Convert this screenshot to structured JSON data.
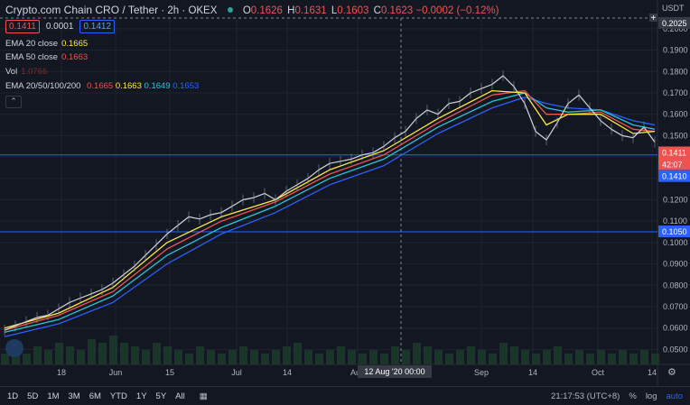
{
  "header": {
    "symbol": "Crypto.com Chain CRO / Tether",
    "interval": "2h",
    "exchange": "OKEX",
    "open_label": "O",
    "open": "0.1626",
    "high_label": "H",
    "high": "0.1631",
    "low_label": "L",
    "low": "0.1603",
    "close_label": "C",
    "close": "0.1623",
    "change": "−0.0002 (−0.12%)"
  },
  "pricebox": {
    "sell": "0.1411",
    "spread": "0.0001",
    "buy": "0.1412"
  },
  "indicators": [
    {
      "label": "EMA 20 close",
      "value": "0.1665",
      "color": "#ffeb3b"
    },
    {
      "label": "EMA 50 close",
      "value": "0.1663",
      "color": "#ef5350"
    },
    {
      "label": "Vol",
      "value": "1.0766",
      "color": "#ef5350"
    },
    {
      "label": "EMA 20/50/100/200",
      "values": [
        "0.1665",
        "0.1663",
        "0.1649",
        "0.1653"
      ],
      "colors": [
        "#ef5350",
        "#ffeb3b",
        "#26c6da",
        "#2962ff"
      ]
    }
  ],
  "axis": {
    "currency": "USDT",
    "ticks": [
      "0.2000",
      "0.1900",
      "0.1800",
      "0.1700",
      "0.1600",
      "0.1500",
      "0.1400",
      "0.1300",
      "0.1200",
      "0.1100",
      "0.1000",
      "0.0900",
      "0.0800",
      "0.0700",
      "0.0600",
      "0.0500"
    ],
    "tick_values": [
      0.2,
      0.19,
      0.18,
      0.17,
      0.16,
      0.15,
      0.14,
      0.13,
      0.12,
      0.11,
      0.1,
      0.09,
      0.08,
      0.07,
      0.06,
      0.05
    ],
    "crosshair_price": "0.2025",
    "current_price": "0.1411",
    "countdown": "42:07",
    "line_1410": "0.1410",
    "line_1050": "0.1050",
    "hline_values": [
      0.141,
      0.105
    ]
  },
  "time_axis": {
    "labels": [
      "18",
      "Jun",
      "15",
      "Jul",
      "14",
      "Aug",
      "Sep",
      "14",
      "Oct",
      "14"
    ],
    "crosshair_label": "12 Aug '20  00:00"
  },
  "bottom": {
    "timeframes": [
      "1D",
      "5D",
      "1M",
      "3M",
      "6M",
      "YTD",
      "1Y",
      "5Y",
      "All"
    ],
    "clock": "21:17:53 (UTC+8)",
    "pct": "%",
    "log": "log",
    "auto": "auto"
  },
  "chart_data": {
    "type": "line",
    "ylim": [
      0.043,
      0.205
    ],
    "series": [
      {
        "name": "Price",
        "color": "#d1d4dc",
        "x": [
          0,
          1,
          2,
          3,
          4,
          5,
          6,
          7,
          8,
          9,
          10,
          11,
          12,
          13,
          14,
          15,
          16,
          17,
          18,
          19,
          20,
          21,
          22,
          23,
          24,
          25,
          26,
          27,
          28,
          29,
          30,
          31,
          32,
          33,
          34,
          35,
          36,
          37,
          38,
          39,
          40,
          41,
          42,
          43,
          44,
          45,
          46,
          47,
          48,
          49,
          50,
          51,
          52,
          53,
          54,
          55,
          56,
          57,
          58,
          59,
          60
        ],
        "y": [
          0.059,
          0.061,
          0.063,
          0.065,
          0.066,
          0.069,
          0.072,
          0.074,
          0.076,
          0.078,
          0.081,
          0.085,
          0.089,
          0.094,
          0.099,
          0.104,
          0.108,
          0.112,
          0.111,
          0.113,
          0.114,
          0.117,
          0.12,
          0.121,
          0.123,
          0.12,
          0.124,
          0.127,
          0.13,
          0.134,
          0.137,
          0.138,
          0.139,
          0.141,
          0.142,
          0.145,
          0.149,
          0.152,
          0.158,
          0.162,
          0.16,
          0.165,
          0.166,
          0.17,
          0.172,
          0.174,
          0.178,
          0.173,
          0.165,
          0.152,
          0.148,
          0.156,
          0.165,
          0.169,
          0.163,
          0.157,
          0.153,
          0.15,
          0.149,
          0.154,
          0.147
        ]
      },
      {
        "name": "EMA 20",
        "color": "#ffeb3b",
        "x": [
          0,
          5,
          10,
          15,
          20,
          25,
          30,
          35,
          40,
          45,
          48,
          50,
          52,
          55,
          58,
          60
        ],
        "y": [
          0.06,
          0.067,
          0.079,
          0.1,
          0.112,
          0.12,
          0.134,
          0.143,
          0.158,
          0.171,
          0.17,
          0.155,
          0.16,
          0.16,
          0.151,
          0.152
        ]
      },
      {
        "name": "EMA 50",
        "color": "#ef5350",
        "x": [
          0,
          5,
          10,
          15,
          20,
          25,
          30,
          35,
          40,
          45,
          48,
          50,
          52,
          55,
          58,
          60
        ],
        "y": [
          0.059,
          0.066,
          0.077,
          0.097,
          0.11,
          0.119,
          0.132,
          0.141,
          0.156,
          0.169,
          0.171,
          0.16,
          0.16,
          0.161,
          0.153,
          0.152
        ]
      },
      {
        "name": "EMA 100",
        "color": "#26c6da",
        "x": [
          0,
          5,
          10,
          15,
          20,
          25,
          30,
          35,
          40,
          45,
          48,
          50,
          52,
          55,
          58,
          60
        ],
        "y": [
          0.058,
          0.064,
          0.075,
          0.094,
          0.107,
          0.117,
          0.13,
          0.139,
          0.154,
          0.166,
          0.17,
          0.163,
          0.161,
          0.162,
          0.155,
          0.153
        ]
      },
      {
        "name": "EMA 200",
        "color": "#2962ff",
        "x": [
          0,
          5,
          10,
          15,
          20,
          25,
          30,
          35,
          40,
          45,
          48,
          50,
          52,
          55,
          58,
          60
        ],
        "y": [
          0.056,
          0.062,
          0.072,
          0.09,
          0.104,
          0.114,
          0.127,
          0.136,
          0.151,
          0.163,
          0.168,
          0.165,
          0.163,
          0.162,
          0.157,
          0.155
        ]
      }
    ],
    "volume": [
      3,
      4,
      3,
      5,
      4,
      6,
      5,
      4,
      7,
      6,
      8,
      6,
      5,
      4,
      6,
      5,
      4,
      3,
      5,
      4,
      3,
      4,
      5,
      4,
      3,
      4,
      5,
      6,
      4,
      3,
      4,
      5,
      4,
      3,
      4,
      3,
      5,
      4,
      6,
      5,
      4,
      3,
      4,
      5,
      4,
      3,
      6,
      5,
      4,
      3,
      4,
      5,
      3,
      4,
      3,
      4,
      3,
      4,
      3,
      4,
      3
    ]
  }
}
